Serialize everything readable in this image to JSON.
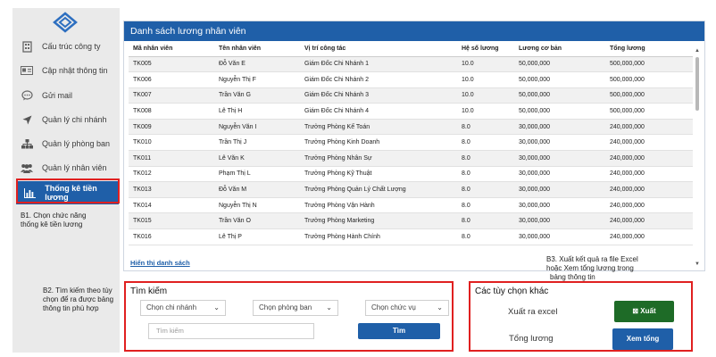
{
  "sidebar": {
    "items": [
      {
        "label": "Cấu trúc công ty",
        "icon": "building-icon"
      },
      {
        "label": "Cập nhật thông tin",
        "icon": "id-card-icon"
      },
      {
        "label": "Gửi mail",
        "icon": "chat-bubble-icon"
      },
      {
        "label": "Quản lý chi nhánh",
        "icon": "location-arrow-icon"
      },
      {
        "label": "Quản lý phòng ban",
        "icon": "sitemap-icon"
      },
      {
        "label": "Quản lý nhân viên",
        "icon": "users-icon"
      },
      {
        "label": "Thống kê tiền lương",
        "icon": "bar-chart-icon"
      }
    ]
  },
  "notes": {
    "b1_line1": "B1. Chọn chức năng",
    "b1_line2": "thống kê tiền lương",
    "b2_line1": "B2. Tìm kiếm theo tùy",
    "b2_line2": "chọn để ra được bảng",
    "b2_line3": "thông tin phù hợp",
    "b3_line1": "B3. Xuất kết quả ra file Excel",
    "b3_line2": "hoặc Xem tổng lương trong",
    "b3_line3": "bảng thông tin"
  },
  "panel": {
    "title": "Danh sách lương nhân viên",
    "columns": [
      "Mã nhân viên",
      "Tên nhân viên",
      "Vị trí công tác",
      "Hệ số lương",
      "Lương cơ bản",
      "Tổng lương"
    ],
    "rows": [
      [
        "TK005",
        "Đỗ Văn E",
        "Giám Đốc Chi Nhánh 1",
        "10.0",
        "50,000,000",
        "500,000,000"
      ],
      [
        "TK006",
        "Nguyễn Thị F",
        "Giám Đốc Chi Nhánh 2",
        "10.0",
        "50,000,000",
        "500,000,000"
      ],
      [
        "TK007",
        "Trần Văn G",
        "Giám Đốc Chi Nhánh 3",
        "10.0",
        "50,000,000",
        "500,000,000"
      ],
      [
        "TK008",
        "Lê Thị H",
        "Giám Đốc Chi Nhánh 4",
        "10.0",
        "50,000,000",
        "500,000,000"
      ],
      [
        "TK009",
        "Nguyễn Văn I",
        "Trưởng Phòng Kế Toán",
        "8.0",
        "30,000,000",
        "240,000,000"
      ],
      [
        "TK010",
        "Trần Thị J",
        "Trưởng Phòng Kinh Doanh",
        "8.0",
        "30,000,000",
        "240,000,000"
      ],
      [
        "TK011",
        "Lê Văn K",
        "Trưởng Phòng Nhân Sự",
        "8.0",
        "30,000,000",
        "240,000,000"
      ],
      [
        "TK012",
        "Phạm Thị L",
        "Trưởng Phòng Kỹ Thuật",
        "8.0",
        "30,000,000",
        "240,000,000"
      ],
      [
        "TK013",
        "Đỗ Văn M",
        "Trưởng Phòng Quản Lý Chất Lượng",
        "8.0",
        "30,000,000",
        "240,000,000"
      ],
      [
        "TK014",
        "Nguyễn Thị N",
        "Trưởng Phòng Vận Hành",
        "8.0",
        "30,000,000",
        "240,000,000"
      ],
      [
        "TK015",
        "Trần Văn O",
        "Trưởng Phòng Marketing",
        "8.0",
        "30,000,000",
        "240,000,000"
      ],
      [
        "TK016",
        "Lê Thị P",
        "Trưởng Phòng Hành Chính",
        "8.0",
        "30,000,000",
        "240,000,000"
      ]
    ],
    "show_link": "Hiển thị danh sách"
  },
  "search": {
    "title": "Tìm kiếm",
    "branch": "Chọn chi nhánh",
    "department": "Chọn phòng ban",
    "position": "Chọn chức vụ",
    "placeholder": "Tìm kiếm",
    "button": "Tìm"
  },
  "options": {
    "title": "Các tùy chọn khác",
    "export_label": "Xuất ra excel",
    "export_button": "Xuất",
    "total_label": "Tổng lương",
    "total_button": "Xem tổng"
  },
  "colors": {
    "primary": "#1f5fa8",
    "highlight": "#e02020",
    "export_green": "#1e6b27"
  }
}
